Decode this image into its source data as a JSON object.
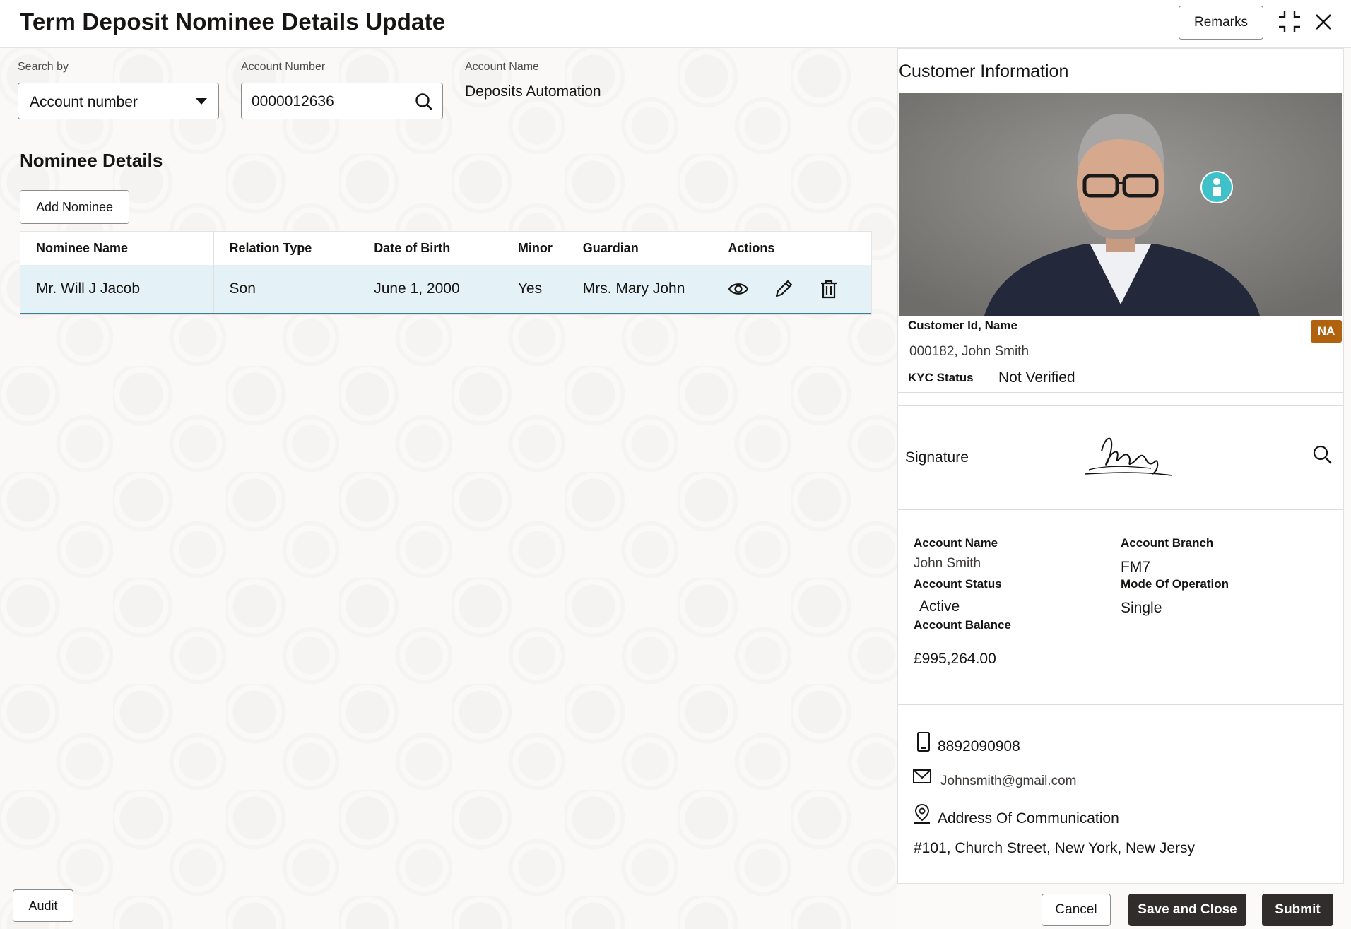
{
  "header": {
    "title": "Term Deposit Nominee Details Update",
    "remarks_label": "Remarks"
  },
  "search": {
    "search_by_label": "Search by",
    "search_by_value": "Account number",
    "account_number_label": "Account Number",
    "account_number_value": "0000012636",
    "account_name_label": "Account Name",
    "account_name_value": "Deposits Automation"
  },
  "nominee": {
    "section_title": "Nominee Details",
    "add_label": "Add Nominee",
    "columns": [
      "Nominee Name",
      "Relation Type",
      "Date of Birth",
      "Minor",
      "Guardian",
      "Actions"
    ],
    "rows": [
      {
        "name": "Mr. Will J Jacob",
        "relation": "Son",
        "dob": "June 1, 2000",
        "minor": "Yes",
        "guardian": "Mrs. Mary  John"
      }
    ]
  },
  "customer": {
    "title": "Customer Information",
    "badge": "NA",
    "id_name_label": "Customer Id, Name",
    "id_name_value": "000182, John Smith",
    "kyc_label": "KYC Status",
    "kyc_value": "Not Verified",
    "signature_label": "Signature",
    "account_name_label": "Account Name",
    "account_name_value": "John Smith",
    "account_branch_label": "Account Branch",
    "account_branch_value": "FM7",
    "account_status_label": "Account Status",
    "account_status_value": "Active",
    "mode_label": "Mode Of Operation",
    "mode_value": "Single",
    "balance_label": "Account Balance",
    "balance_value": "£995,264.00",
    "phone": "8892090908",
    "email": "Johnsmith@gmail.com",
    "address_label": "Address Of Communication",
    "address_value": "#101, Church Street, New York, New Jersy"
  },
  "footer": {
    "audit_label": "Audit",
    "cancel_label": "Cancel",
    "save_close_label": "Save and Close",
    "submit_label": "Submit"
  },
  "icons": {
    "collapse": "collapse-icon",
    "close": "close-icon",
    "search": "search-icon",
    "caret": "chevron-down-icon",
    "view": "eye-icon",
    "edit": "pencil-icon",
    "delete": "trash-icon",
    "phone": "phone-icon",
    "email": "mail-icon",
    "location": "location-pin-icon"
  },
  "colors": {
    "primary_button": "#312d2a",
    "row_highlight": "#e4f1f6",
    "badge": "#b0620f",
    "accent_teal": "#3fc1c9"
  }
}
